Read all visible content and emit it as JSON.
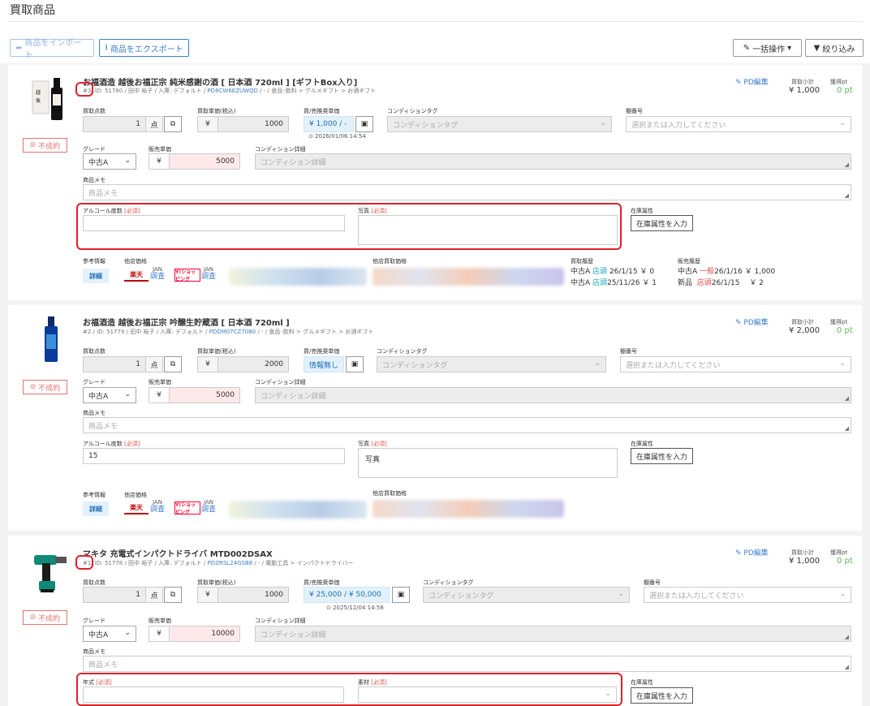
{
  "page": {
    "title": "買取商品"
  },
  "toolbar": {
    "import_label": "商品をインポート",
    "export_label": "商品をエクスポート",
    "bulk_label": "一括操作",
    "filter_label": "絞り込み"
  },
  "labels": {
    "qty": "買取点数",
    "unit_price": "買取単価(税込)",
    "buy_sell": "買/売推奨単価",
    "cond_tag": "コンディションタグ",
    "shelf": "棚番号",
    "grade": "グレード",
    "sale_price": "販売単価",
    "cond_detail": "コンディション詳細",
    "memo": "商品メモ",
    "stock_attr": "在庫属性",
    "ref_info": "参考情報",
    "other_price": "他店価格",
    "other_buy_price": "他店買取価格",
    "buy_history": "買取履歴",
    "sale_history": "販売履歴",
    "pd_edit": "PD編集",
    "subtotal": "買取小計",
    "points": "獲得pt",
    "required": "[必須]",
    "unit_ten": "点",
    "yen": "¥",
    "fail": "不成約",
    "detail": "詳細",
    "jan": "JAN",
    "jan_link": "調査",
    "stock_btn": "在庫属性を入力"
  },
  "placeholders": {
    "cond_tag": "コンディションタグ",
    "shelf": "選択または入力してください",
    "cond_detail": "コンディション詳細",
    "memo": "商品メモ",
    "photo": "写真"
  },
  "items": [
    {
      "title": "お福酒造 越後お福正宗 純米感謝の酒 [ 日本酒 720ml ] [ギフトBox入り]",
      "index": "#3",
      "meta_pre": "/ ID: 51780 / 田中 裕子 / 入庫: デフォルト / ",
      "product_code": "PD8CW6EZUWQD",
      "meta_post": " / - / 食品･飲料 > グルメギフト > お酒ギフト",
      "qty": "1",
      "unit_price": "1000",
      "buy_sell": "¥ 1,000 / -",
      "ts": "⊙ 2026/01/06 14:54",
      "grade": "中古A",
      "sale_price": "5000",
      "attr1_label": "アルコール度数",
      "attr1_value": "",
      "attr2_label": "写真",
      "attr2_value": "",
      "subtotal": "¥ 1,000",
      "points": "0 pt",
      "hist_buy": [
        {
          "grade": "中古A",
          "store": "店頭",
          "rest": "26/1/15 ￥ 0"
        },
        {
          "grade": "中古A",
          "store": "店頭",
          "rest": "25/11/26 ￥ 1"
        }
      ],
      "hist_sale": [
        {
          "grade": "中古A",
          "store": "一般",
          "rest": "26/1/16 ￥ 1,000"
        },
        {
          "grade": "新品",
          "store": "店頭",
          "rest": "26/1/15　 ￥ 2"
        }
      ]
    },
    {
      "title": "お福酒造 越後お福正宗 吟醸生貯蔵酒 [ 日本酒 720ml ]",
      "index": "#2",
      "meta_pre": " / ID: 51779 / 田中 裕子 / 入庫: デフォルト / ",
      "product_code": "PDDM07CZ7080",
      "meta_post": " / - / 食品･飲料 > グルメギフト > お酒ギフト",
      "qty": "1",
      "unit_price": "2000",
      "buy_sell": "情報無し",
      "grade": "中古A",
      "sale_price": "5000",
      "attr1_label": "アルコール度数",
      "attr1_value": "15",
      "attr2_label": "写真",
      "attr2_value": "写真",
      "subtotal": "¥ 2,000",
      "points": "0 pt"
    },
    {
      "title": "マキタ 充電式インパクトドライバ MTD002DSAX",
      "index": "#1",
      "meta_pre": "/ ID: 51778 / 田中 裕子 / 入庫: デフォルト / ",
      "product_code": "PDZRSL24GSB8",
      "meta_post": " / - / 電動工具 > インパクトドライバー",
      "qty": "1",
      "unit_price": "1000",
      "buy_sell": "¥ 25,000 / ¥ 50,000",
      "ts": "⊙ 2025/12/04 14:58",
      "grade": "中古A",
      "sale_price": "10000",
      "attr1_label": "年式",
      "attr1_value": "",
      "attr2_label": "素材",
      "attr2_value": "",
      "subtotal": "¥ 1,000",
      "points": "0 pt"
    }
  ]
}
